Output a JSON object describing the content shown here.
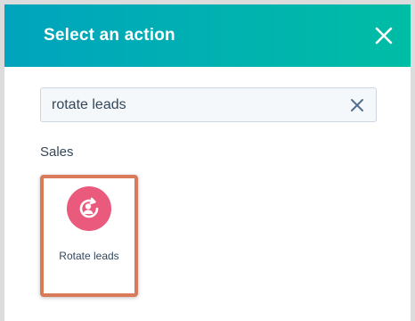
{
  "dialog": {
    "title": "Select an action",
    "close_icon": "close-icon"
  },
  "search": {
    "value": "rotate leads",
    "clear_icon": "clear-icon"
  },
  "sections": [
    {
      "label": "Sales",
      "actions": [
        {
          "label": "Rotate leads",
          "icon": "rotate-user-icon"
        }
      ]
    }
  ],
  "colors": {
    "header_gradient_start": "#00a4bd",
    "header_gradient_end": "#00bda5",
    "action_icon_bg": "#ea5a7c",
    "card_highlight_border": "#d97a5b",
    "text": "#33475b"
  }
}
